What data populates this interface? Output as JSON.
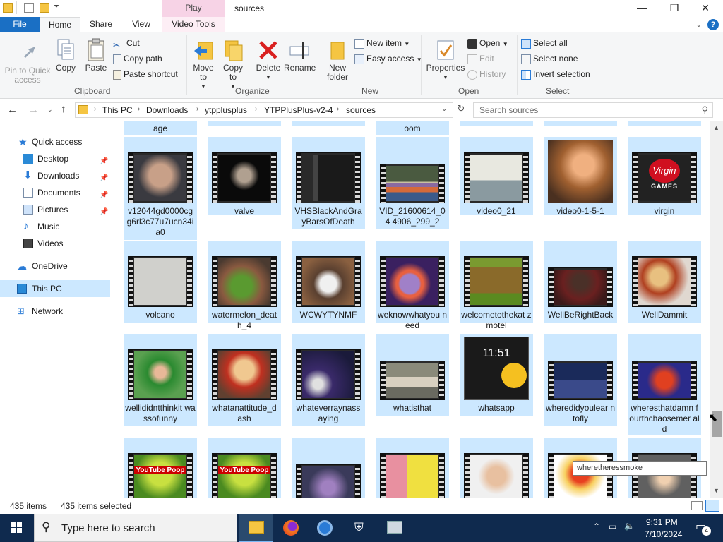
{
  "window": {
    "title": "sources",
    "context_tab": "Play",
    "controls": {
      "minimize": "—",
      "maximize": "❐",
      "close": "✕"
    }
  },
  "ribbon_tabs": [
    "File",
    "Home",
    "Share",
    "View",
    "Video Tools"
  ],
  "help_icon": "?",
  "ribbon": {
    "clipboard": {
      "pin": "Pin to Quick access",
      "copy": "Copy",
      "paste": "Paste",
      "cut": "Cut",
      "copy_path": "Copy path",
      "paste_shortcut": "Paste shortcut",
      "label": "Clipboard"
    },
    "organize": {
      "move_to": "Move to",
      "copy_to": "Copy to",
      "delete": "Delete",
      "rename": "Rename",
      "label": "Organize"
    },
    "new": {
      "new_folder": "New folder",
      "new_item": "New item",
      "easy_access": "Easy access",
      "label": "New"
    },
    "open": {
      "properties": "Properties",
      "open": "Open",
      "edit": "Edit",
      "history": "History",
      "label": "Open"
    },
    "select": {
      "select_all": "Select all",
      "select_none": "Select none",
      "invert": "Invert selection",
      "label": "Select"
    }
  },
  "address": {
    "crumbs": [
      "This PC",
      "Downloads",
      "ytpplusplus",
      "YTPPlusPlus-v2-4",
      "sources"
    ],
    "search_placeholder": "Search sources"
  },
  "nav": {
    "quick_access": "Quick access",
    "desktop": "Desktop",
    "downloads": "Downloads",
    "documents": "Documents",
    "pictures": "Pictures",
    "music": "Music",
    "videos": "Videos",
    "onedrive": "OneDrive",
    "this_pc": "This PC",
    "network": "Network"
  },
  "files": {
    "partial_top": [
      "age",
      "oom"
    ],
    "row1": [
      "v12044gd0000cg g6rl3c77u7ucn34i a0",
      "valve",
      "VHSBlackAndGra yBarsOfDeath",
      "VID_21600614_04 4906_299_2",
      "video0_21",
      "video0-1-5-1",
      "virgin"
    ],
    "row2": [
      "volcano",
      "watermelon_deat h_4",
      "WCWYTYNMF",
      "weknowwhatyou need",
      "welcometothekat zmotel",
      "WellBeRightBack",
      "WellDammit"
    ],
    "row3": [
      "wellididntthinkit wassofunny",
      "whatanattitude_d ash",
      "whateverraynass aying",
      "whatisthat",
      "whatsapp",
      "wheredidyoulear ntofly",
      "wheresthatdamn fourthchaosemer ald"
    ],
    "whatsapp_time": "11:51",
    "virgin_text": "Virgin",
    "virgin_games": "GAMES",
    "youtube_poop": "YouTube Poop"
  },
  "tooltip": "wheretheressmoke",
  "status": {
    "items": "435 items",
    "selected": "435 items selected"
  },
  "taskbar": {
    "search_placeholder": "Type here to search",
    "time": "9:31 PM",
    "date": "7/10/2024",
    "notifications": "4"
  }
}
